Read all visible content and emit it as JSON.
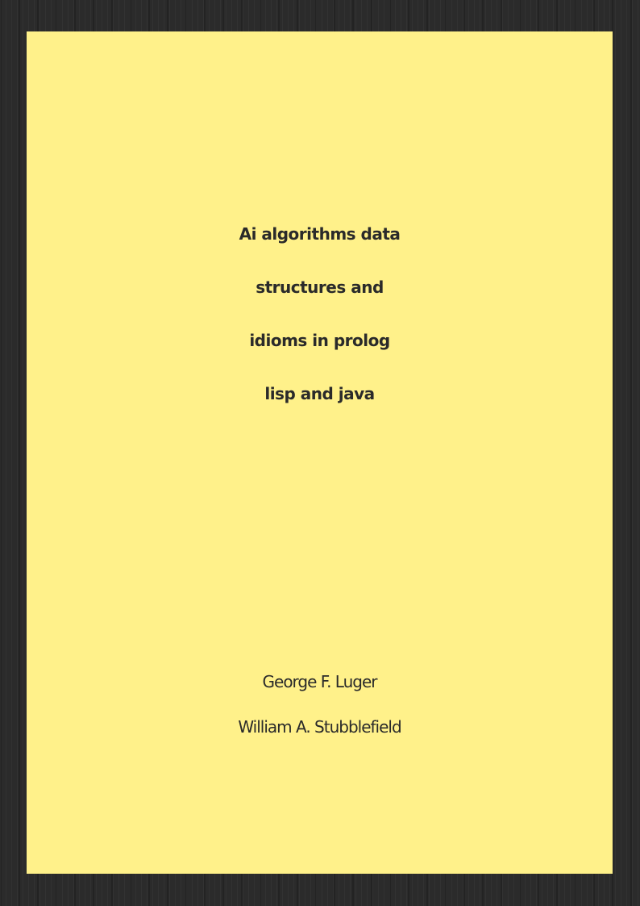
{
  "cover": {
    "background_color": "#fff18a",
    "frame_color": "#2b2b2b",
    "text_color": "#2a2a2a",
    "title_lines": [
      "Ai algorithms data",
      "structures and",
      "idioms in prolog",
      "lisp and java"
    ],
    "authors": [
      "George F. Luger",
      "William A. Stubblefield"
    ]
  }
}
